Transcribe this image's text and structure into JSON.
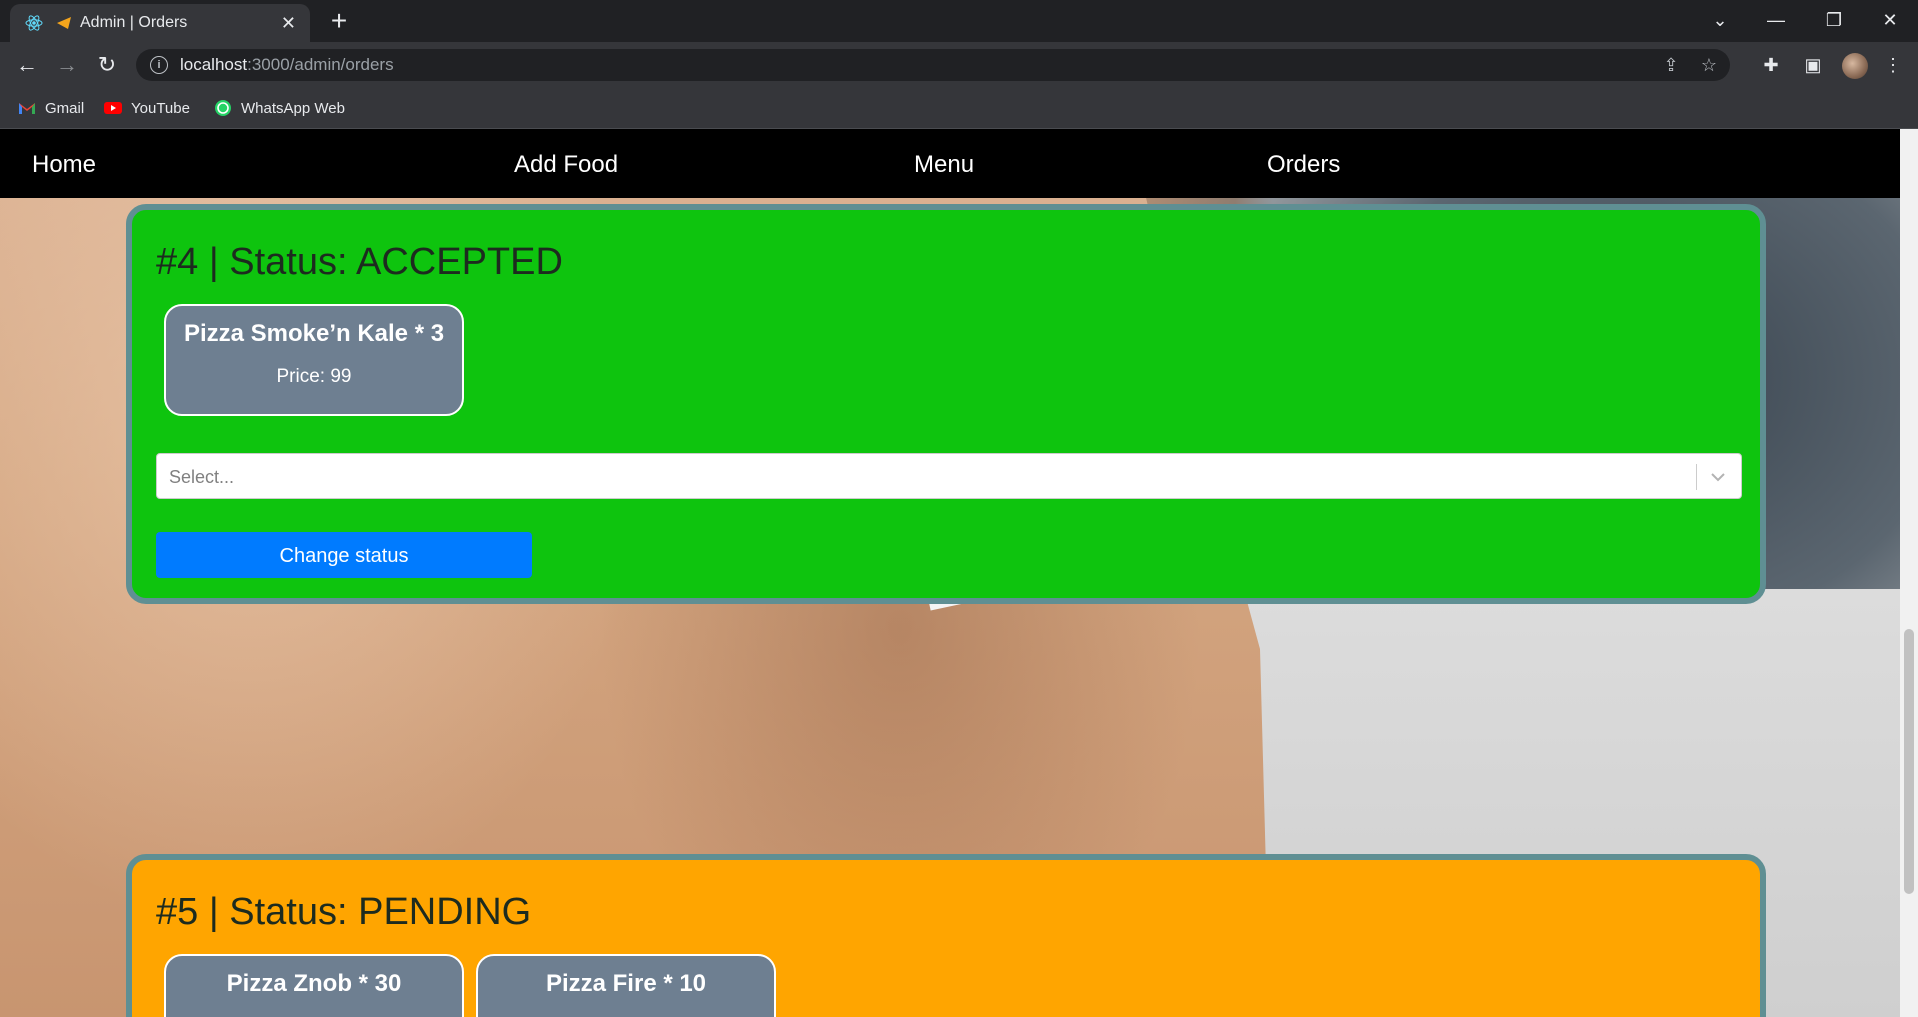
{
  "browser": {
    "tab_title": "Admin | Orders",
    "url_host": "localhost",
    "url_path": ":3000/admin/orders",
    "bookmarks": [
      {
        "label": "Gmail",
        "icon": "gmail-icon"
      },
      {
        "label": "YouTube",
        "icon": "youtube-icon"
      },
      {
        "label": "WhatsApp Web",
        "icon": "whatsapp-icon"
      }
    ]
  },
  "navbar": {
    "links": [
      "Home",
      "Add Food",
      "Menu",
      "Orders"
    ]
  },
  "orders": [
    {
      "title": "#4 | Status: ACCEPTED",
      "color": "#0ec40e",
      "items": [
        {
          "name": "Pizza Smoke’n Kale * 3",
          "price": "Price: 99"
        }
      ],
      "select_placeholder": "Select...",
      "button_label": "Change status"
    },
    {
      "title": "#5 | Status: PENDING",
      "color": "#ffa500",
      "items": [
        {
          "name": "Pizza Znob * 30"
        },
        {
          "name": "Pizza Fire * 10"
        }
      ]
    }
  ],
  "colors": {
    "navbar_bg": "#000000",
    "button_blue": "#007bff",
    "item_card_bg": "#6e7f91",
    "card_border": "#5f8f93"
  }
}
